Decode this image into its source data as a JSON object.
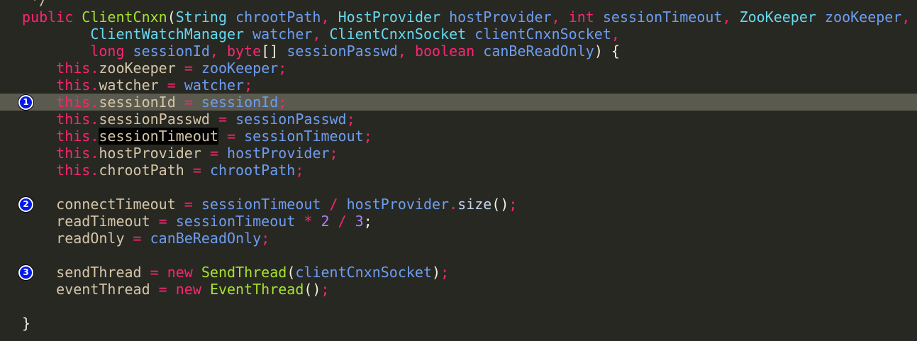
{
  "editor": {
    "lines": [
      [
        [
          " */",
          "f"
        ]
      ],
      [
        [
          "public ",
          "k"
        ],
        [
          "ClientCnxn",
          "c"
        ],
        [
          "(",
          "d"
        ],
        [
          "String ",
          "t"
        ],
        [
          "chrootPath",
          "p"
        ],
        [
          ", ",
          "o"
        ],
        [
          "HostProvider ",
          "t"
        ],
        [
          "hostProvider",
          "p"
        ],
        [
          ", ",
          "o"
        ],
        [
          "int ",
          "k"
        ],
        [
          "sessionTimeout",
          "p"
        ],
        [
          ", ",
          "o"
        ],
        [
          "ZooKeeper ",
          "t"
        ],
        [
          "zooKeeper",
          "p"
        ],
        [
          ",",
          "o"
        ]
      ],
      [
        [
          "        ",
          "d"
        ],
        [
          "ClientWatchManager ",
          "t"
        ],
        [
          "watcher",
          "p"
        ],
        [
          ", ",
          "o"
        ],
        [
          "ClientCnxnSocket ",
          "t"
        ],
        [
          "clientCnxnSocket",
          "p"
        ],
        [
          ",",
          "o"
        ]
      ],
      [
        [
          "        ",
          "d"
        ],
        [
          "long ",
          "k"
        ],
        [
          "sessionId",
          "p"
        ],
        [
          ", ",
          "o"
        ],
        [
          "byte",
          "k"
        ],
        [
          "[] ",
          "d"
        ],
        [
          "sessionPasswd",
          "p"
        ],
        [
          ", ",
          "o"
        ],
        [
          "boolean ",
          "k"
        ],
        [
          "canBeReadOnly",
          "p"
        ],
        [
          ") {",
          "d"
        ]
      ],
      [
        [
          "    ",
          "d"
        ],
        [
          "this",
          "k"
        ],
        [
          ".",
          "o"
        ],
        [
          "zooKeeper ",
          "f"
        ],
        [
          "= ",
          "o"
        ],
        [
          "zooKeeper",
          "p"
        ],
        [
          ";",
          "o"
        ]
      ],
      [
        [
          "    ",
          "d"
        ],
        [
          "this",
          "k"
        ],
        [
          ".",
          "o"
        ],
        [
          "watcher ",
          "f"
        ],
        [
          "= ",
          "o"
        ],
        [
          "watcher",
          "p"
        ],
        [
          ";",
          "o"
        ]
      ],
      [
        [
          "    ",
          "d"
        ],
        [
          "this",
          "k"
        ],
        [
          ".",
          "o"
        ],
        [
          "sessionId ",
          "f"
        ],
        [
          "= ",
          "o"
        ],
        [
          "sessionId",
          "p"
        ],
        [
          ";",
          "o"
        ]
      ],
      [
        [
          "    ",
          "d"
        ],
        [
          "this",
          "k"
        ],
        [
          ".",
          "o"
        ],
        [
          "sessionPasswd ",
          "f"
        ],
        [
          "= ",
          "o"
        ],
        [
          "sessionPasswd",
          "p"
        ],
        [
          ";",
          "o"
        ]
      ],
      [
        [
          "    ",
          "d"
        ],
        [
          "this",
          "k"
        ],
        [
          ".",
          "o"
        ],
        [
          "sessionTimeout",
          "sel"
        ],
        [
          " ",
          "d"
        ],
        [
          "= ",
          "o"
        ],
        [
          "sessionTimeout",
          "p"
        ],
        [
          ";",
          "o"
        ]
      ],
      [
        [
          "    ",
          "d"
        ],
        [
          "this",
          "k"
        ],
        [
          ".",
          "o"
        ],
        [
          "hostProvider ",
          "f"
        ],
        [
          "= ",
          "o"
        ],
        [
          "hostProvider",
          "p"
        ],
        [
          ";",
          "o"
        ]
      ],
      [
        [
          "    ",
          "d"
        ],
        [
          "this",
          "k"
        ],
        [
          ".",
          "o"
        ],
        [
          "chrootPath ",
          "f"
        ],
        [
          "= ",
          "o"
        ],
        [
          "chrootPath",
          "p"
        ],
        [
          ";",
          "o"
        ]
      ],
      [],
      [
        [
          "    ",
          "d"
        ],
        [
          "connectTimeout ",
          "f"
        ],
        [
          "= ",
          "o"
        ],
        [
          "sessionTimeout ",
          "p"
        ],
        [
          "/ ",
          "o"
        ],
        [
          "hostProvider",
          "p"
        ],
        [
          ".",
          "o"
        ],
        [
          "size",
          "m"
        ],
        [
          "()",
          "d"
        ],
        [
          ";",
          "o"
        ]
      ],
      [
        [
          "    ",
          "d"
        ],
        [
          "readTimeout ",
          "f"
        ],
        [
          "= ",
          "o"
        ],
        [
          "sessionTimeout ",
          "p"
        ],
        [
          "* ",
          "o"
        ],
        [
          "2 ",
          "n"
        ],
        [
          "/ ",
          "o"
        ],
        [
          "3",
          "n"
        ],
        [
          ";",
          "d"
        ]
      ],
      [
        [
          "    ",
          "d"
        ],
        [
          "readOnly ",
          "f"
        ],
        [
          "= ",
          "o"
        ],
        [
          "canBeReadOnly",
          "p"
        ],
        [
          ";",
          "o"
        ]
      ],
      [],
      [
        [
          "    ",
          "d"
        ],
        [
          "sendThread ",
          "f"
        ],
        [
          "= ",
          "o"
        ],
        [
          "new ",
          "k"
        ],
        [
          "SendThread",
          "c"
        ],
        [
          "(",
          "d"
        ],
        [
          "clientCnxnSocket",
          "p"
        ],
        [
          ")",
          "d"
        ],
        [
          ";",
          "o"
        ]
      ],
      [
        [
          "    ",
          "d"
        ],
        [
          "eventThread ",
          "f"
        ],
        [
          "= ",
          "o"
        ],
        [
          "new ",
          "k"
        ],
        [
          "EventThread",
          "c"
        ],
        [
          "()",
          "d"
        ],
        [
          ";",
          "o"
        ]
      ],
      [],
      [
        [
          "}",
          "d"
        ]
      ]
    ],
    "markers": [
      {
        "label": "1",
        "line": 6
      },
      {
        "label": "2",
        "line": 12
      },
      {
        "label": "3",
        "line": 16
      }
    ]
  }
}
